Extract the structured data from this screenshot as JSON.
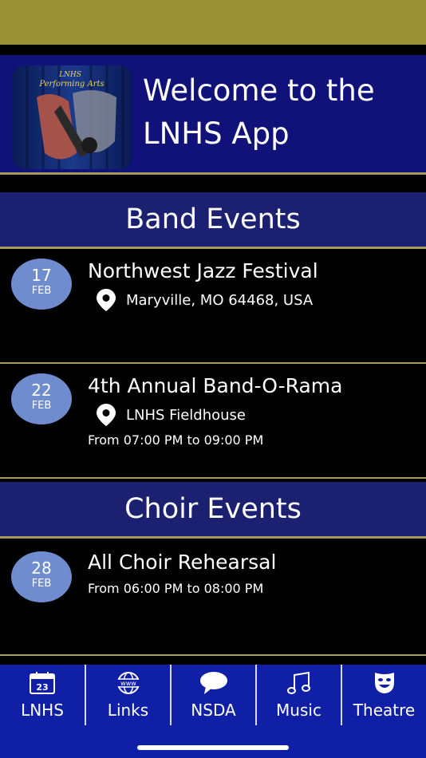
{
  "hero": {
    "logo_text": "LNHS Performing Arts",
    "title": "Welcome to the LNHS App"
  },
  "sections": [
    {
      "header": "Band Events",
      "events": [
        {
          "day": "17",
          "month": "FEB",
          "title": "Northwest Jazz Festival",
          "location": "Maryville, MO 64468, USA",
          "time": ""
        },
        {
          "day": "22",
          "month": "FEB",
          "title": "4th Annual Band-O-Rama",
          "location": "LNHS Fieldhouse",
          "time": "From 07:00 PM to 09:00 PM"
        }
      ]
    },
    {
      "header": "Choir Events",
      "events": [
        {
          "day": "28",
          "month": "FEB",
          "title": "All Choir Rehearsal",
          "location": "",
          "time": "From 06:00 PM to 08:00 PM"
        }
      ]
    }
  ],
  "tabs": [
    {
      "label": "LNHS",
      "icon": "calendar-icon",
      "icon_text": "23"
    },
    {
      "label": "Links",
      "icon": "globe-www-icon",
      "icon_text": "www"
    },
    {
      "label": "NSDA",
      "icon": "speech-bubble-icon"
    },
    {
      "label": "Music",
      "icon": "music-note-icon"
    },
    {
      "label": "Theatre",
      "icon": "theatre-mask-icon"
    }
  ],
  "colors": {
    "status_bar": "#9a9136",
    "hero_bg": "#10127a",
    "section_bg": "#1c2070",
    "divider": "#a79a5e",
    "date_badge": "#6f8ccf",
    "tab_bar": "#1020a6"
  }
}
